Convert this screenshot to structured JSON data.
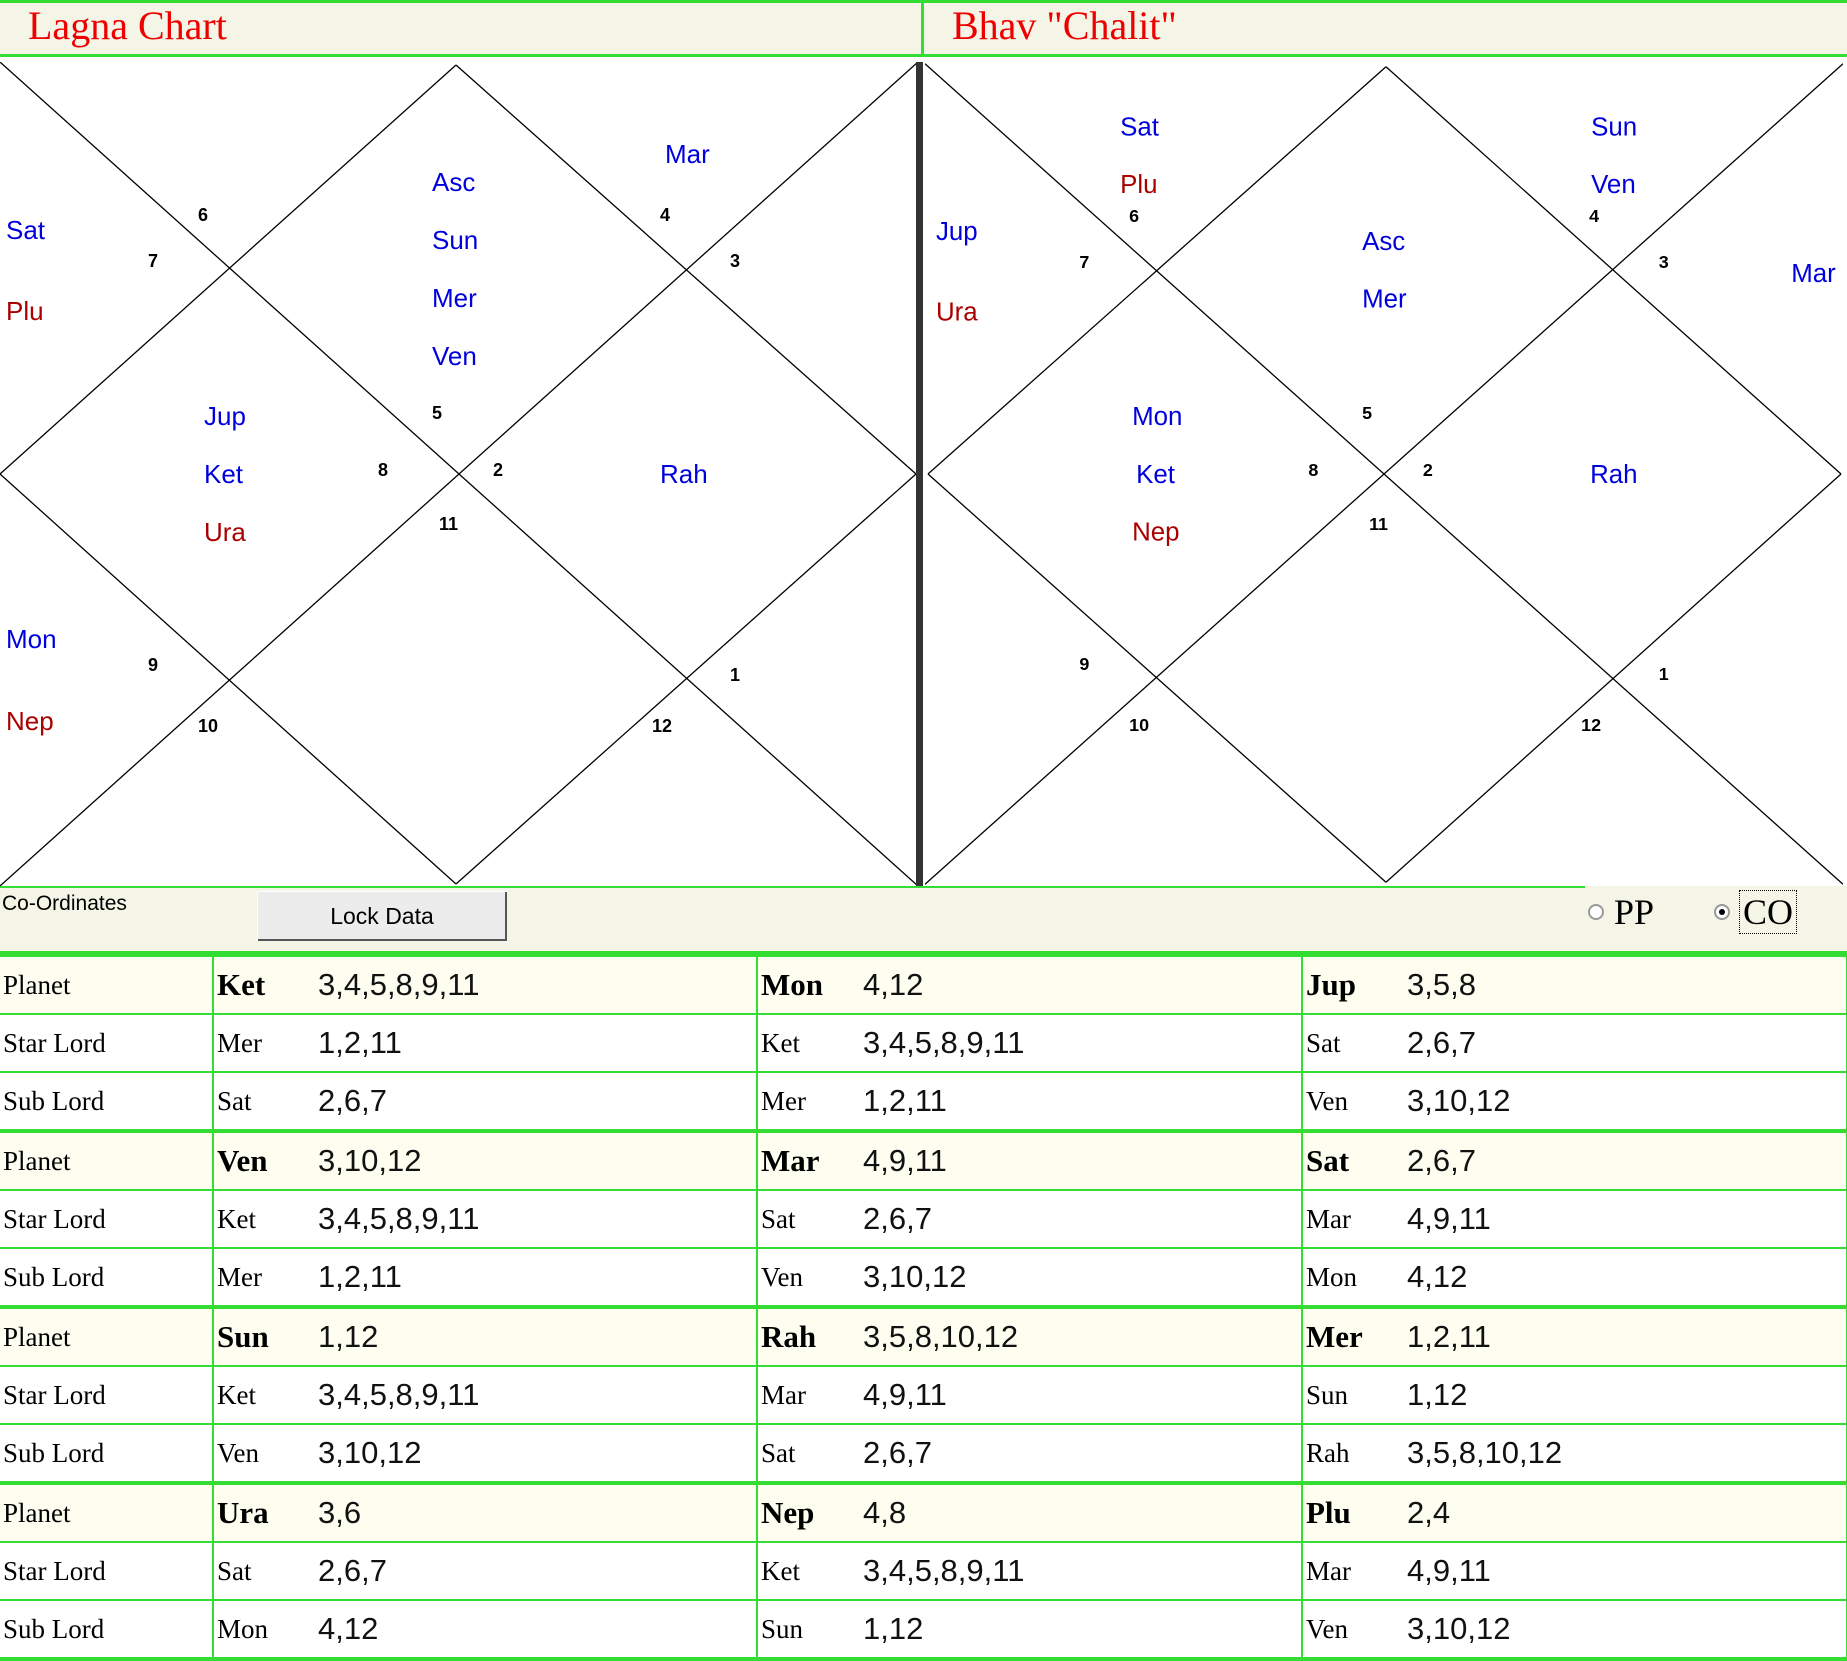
{
  "headers": {
    "left_title": "Lagna Chart",
    "right_title": "Bhav \"Chalit\""
  },
  "house_numbers": [
    "1",
    "2",
    "3",
    "4",
    "5",
    "6",
    "7",
    "8",
    "9",
    "10",
    "11",
    "12"
  ],
  "lagna_chart": {
    "asc": "Asc",
    "sun": "Sun",
    "mer": "Mer",
    "ven": "Ven",
    "mar": "Mar",
    "sat": "Sat",
    "plu": "Plu",
    "jup": "Jup",
    "ket": "Ket",
    "ura": "Ura",
    "rah": "Rah",
    "mon": "Mon",
    "nep": "Nep"
  },
  "bhav_chart": {
    "sat": "Sat",
    "plu": "Plu",
    "sun": "Sun",
    "ven": "Ven",
    "jup": "Jup",
    "ura": "Ura",
    "asc": "Asc",
    "mer": "Mer",
    "mar": "Mar",
    "mon": "Mon",
    "ket": "Ket",
    "nep": "Nep",
    "rah": "Rah"
  },
  "colors": {
    "blue_planet": "#0000dd",
    "red_planet": "#aa0000",
    "header_text": "#ee0000",
    "grid_green": "#33dd33"
  },
  "controls": {
    "coordinates_label": "Co-Ordinates",
    "lock_button": "Lock Data",
    "radio_pp": "PP",
    "radio_co": "CO",
    "selected": "CO"
  },
  "table": {
    "groups": [
      {
        "rows": [
          {
            "role": "Planet",
            "cells": [
              [
                "Ket",
                "3,4,5,8,9,11"
              ],
              [
                "Mon",
                "4,12"
              ],
              [
                "Jup",
                "3,5,8"
              ]
            ]
          },
          {
            "role": "Star Lord",
            "cells": [
              [
                "Mer",
                "1,2,11"
              ],
              [
                "Ket",
                "3,4,5,8,9,11"
              ],
              [
                "Sat",
                "2,6,7"
              ]
            ]
          },
          {
            "role": "Sub Lord",
            "cells": [
              [
                "Sat",
                "2,6,7"
              ],
              [
                "Mer",
                "1,2,11"
              ],
              [
                "Ven",
                "3,10,12"
              ]
            ]
          }
        ]
      },
      {
        "rows": [
          {
            "role": "Planet",
            "cells": [
              [
                "Ven",
                "3,10,12"
              ],
              [
                "Mar",
                "4,9,11"
              ],
              [
                "Sat",
                "2,6,7"
              ]
            ]
          },
          {
            "role": "Star Lord",
            "cells": [
              [
                "Ket",
                "3,4,5,8,9,11"
              ],
              [
                "Sat",
                "2,6,7"
              ],
              [
                "Mar",
                "4,9,11"
              ]
            ]
          },
          {
            "role": "Sub Lord",
            "cells": [
              [
                "Mer",
                "1,2,11"
              ],
              [
                "Ven",
                "3,10,12"
              ],
              [
                "Mon",
                "4,12"
              ]
            ]
          }
        ]
      },
      {
        "rows": [
          {
            "role": "Planet",
            "cells": [
              [
                "Sun",
                "1,12"
              ],
              [
                "Rah",
                "3,5,8,10,12"
              ],
              [
                "Mer",
                "1,2,11"
              ]
            ]
          },
          {
            "role": "Star Lord",
            "cells": [
              [
                "Ket",
                "3,4,5,8,9,11"
              ],
              [
                "Mar",
                "4,9,11"
              ],
              [
                "Sun",
                "1,12"
              ]
            ]
          },
          {
            "role": "Sub Lord",
            "cells": [
              [
                "Ven",
                "3,10,12"
              ],
              [
                "Sat",
                "2,6,7"
              ],
              [
                "Rah",
                "3,5,8,10,12"
              ]
            ]
          }
        ]
      },
      {
        "rows": [
          {
            "role": "Planet",
            "cells": [
              [
                "Ura",
                "3,6"
              ],
              [
                "Nep",
                "4,8"
              ],
              [
                "Plu",
                "2,4"
              ]
            ]
          },
          {
            "role": "Star Lord",
            "cells": [
              [
                "Sat",
                "2,6,7"
              ],
              [
                "Ket",
                "3,4,5,8,9,11"
              ],
              [
                "Mar",
                "4,9,11"
              ]
            ]
          },
          {
            "role": "Sub Lord",
            "cells": [
              [
                "Mon",
                "4,12"
              ],
              [
                "Sun",
                "1,12"
              ],
              [
                "Ven",
                "3,10,12"
              ]
            ]
          }
        ]
      }
    ]
  }
}
